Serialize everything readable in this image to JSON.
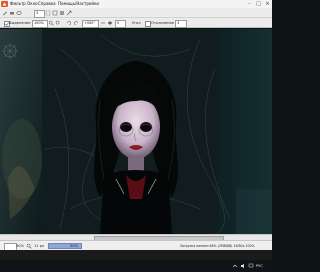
{
  "menu": {
    "items": [
      "Фильтр",
      "Окно",
      "Справка",
      "Помощь/Настройки"
    ]
  },
  "toolbar": {
    "size_value": "3",
    "zoom_value": "100%",
    "angle_value": "+000°",
    "flow_value": "0",
    "flip_label": "Угол",
    "stabilizer_label": "Отклонение",
    "selection_label": "Выделение",
    "selection_checked": true
  },
  "canvas": {
    "background_color": "#0c1517"
  },
  "status": {
    "zoom_a": "50%",
    "zoom_b": "50%",
    "zoom_b_mode": "11 px",
    "info_text": "Загрузка памяти:48% (2MB/8B) 19/80x 100%"
  },
  "taskbar": {
    "lang": "РУС",
    "bg_color": "#101418"
  },
  "colors": {
    "accent_blue": "#8fa6d6",
    "toolbar_bg": "#ececec"
  }
}
